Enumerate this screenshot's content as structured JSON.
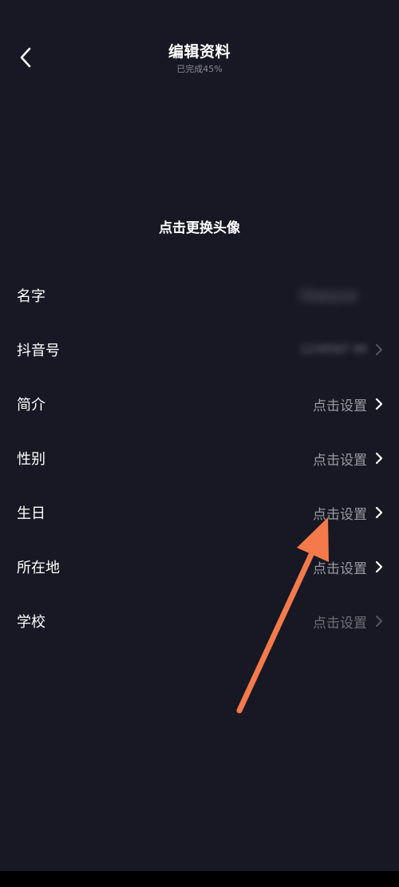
{
  "header": {
    "title": "编辑资料",
    "subtitle": "已完成45%",
    "back_icon": "chevron-left-icon"
  },
  "avatar": {
    "hint": "点击更换头像"
  },
  "profile_fields": [
    {
      "label": "名字",
      "value": "Xiaoyue",
      "value_blurred": true
    },
    {
      "label": "抖音号",
      "value": "1234567 40",
      "value_blurred": true
    },
    {
      "label": "简介",
      "value": "点击设置"
    },
    {
      "label": "性别",
      "value": "点击设置"
    },
    {
      "label": "生日",
      "value": "点击设置"
    },
    {
      "label": "所在地",
      "value": "点击设置"
    },
    {
      "label": "学校",
      "value": "点击设置"
    }
  ],
  "annotation": {
    "arrow_color": "#f47a4c"
  },
  "colors": {
    "background": "#181824",
    "primary_text": "#ffffff",
    "secondary_text": "#9a9aa4"
  }
}
